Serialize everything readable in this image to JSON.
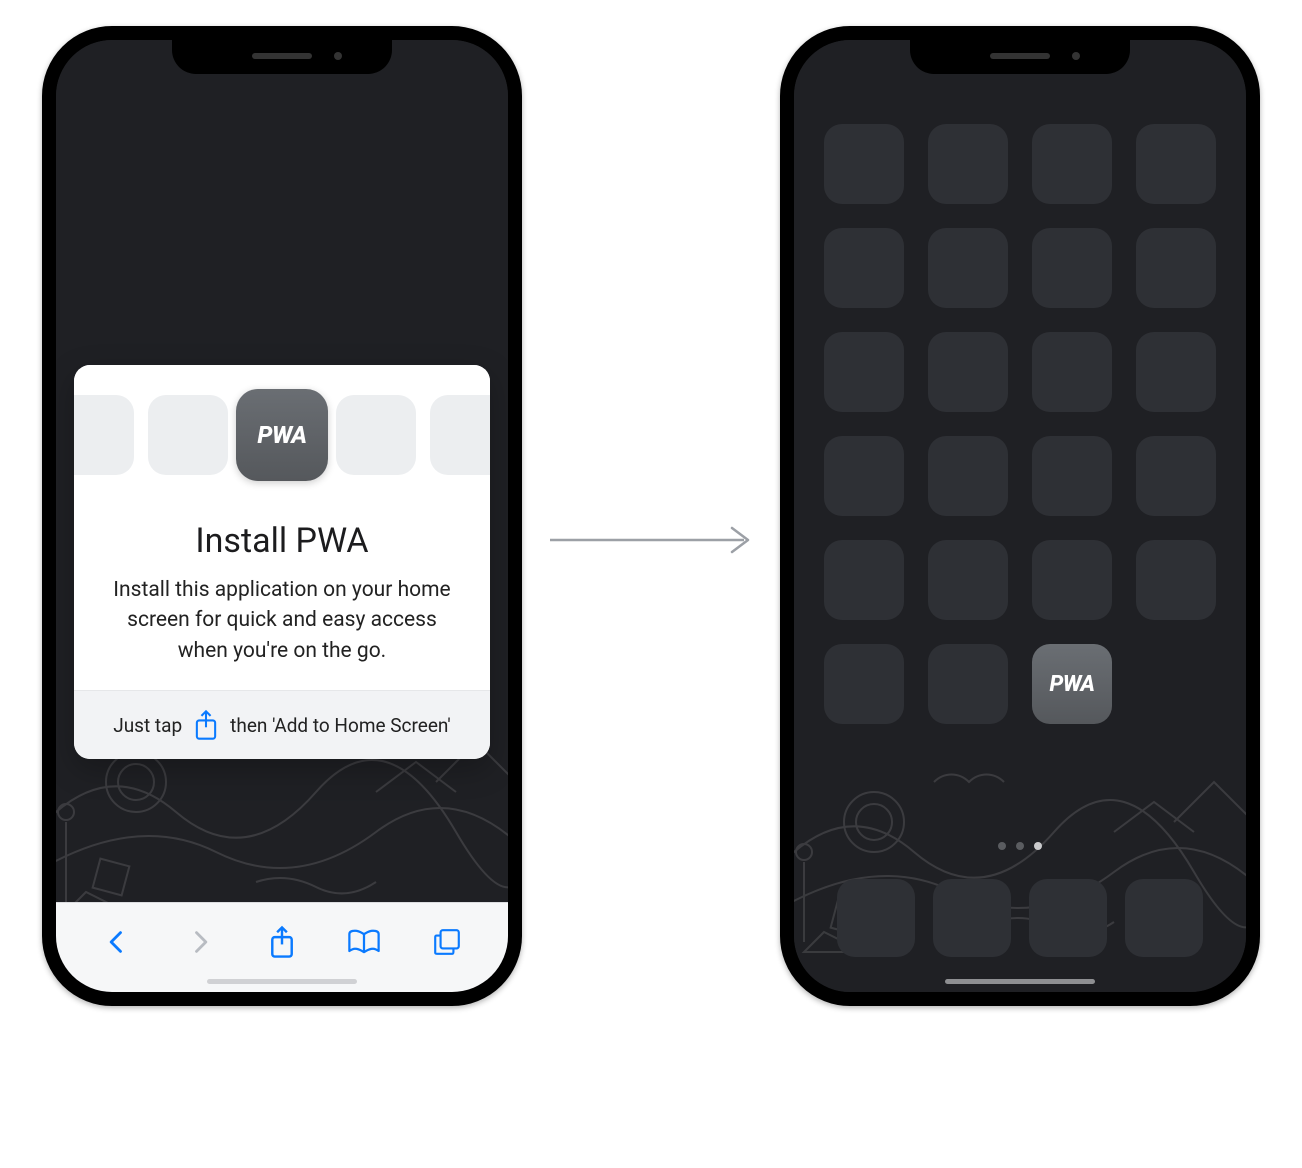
{
  "icons": {
    "pwa_text": "PWA"
  },
  "card": {
    "title": "Install PWA",
    "description": "Install this application on your home screen for quick and easy access when you're on the go.",
    "footer_prefix": "Just tap",
    "footer_suffix": "then 'Add to Home Screen'"
  },
  "home": {
    "dots_total": 3,
    "active_dot": 2
  }
}
